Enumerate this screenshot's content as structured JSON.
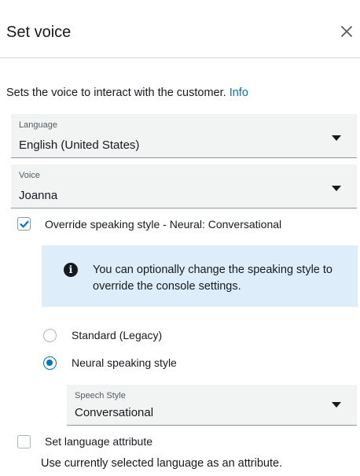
{
  "header": {
    "title": "Set voice",
    "close_icon": "close-icon"
  },
  "description": {
    "text": "Sets the voice to interact with the customer.",
    "info_link": "Info"
  },
  "language": {
    "label": "Language",
    "value": "English (United States)"
  },
  "voice": {
    "label": "Voice",
    "value": "Joanna"
  },
  "override": {
    "label": "Override speaking style - Neural: Conversational",
    "checked": true
  },
  "info_box": {
    "icon": "info-icon",
    "message": "You can optionally change the speaking style to override the console settings."
  },
  "style_options": [
    {
      "label": "Standard (Legacy)",
      "selected": false
    },
    {
      "label": "Neural speaking style",
      "selected": true
    }
  ],
  "speech_style": {
    "label": "Speech Style",
    "value": "Conversational"
  },
  "language_attribute": {
    "label": "Set language attribute",
    "checked": false,
    "hint": "Use currently selected language as an attribute."
  },
  "colors": {
    "accent": "#0073bb",
    "link": "#0073bb",
    "info_bg": "#ddeefa"
  }
}
